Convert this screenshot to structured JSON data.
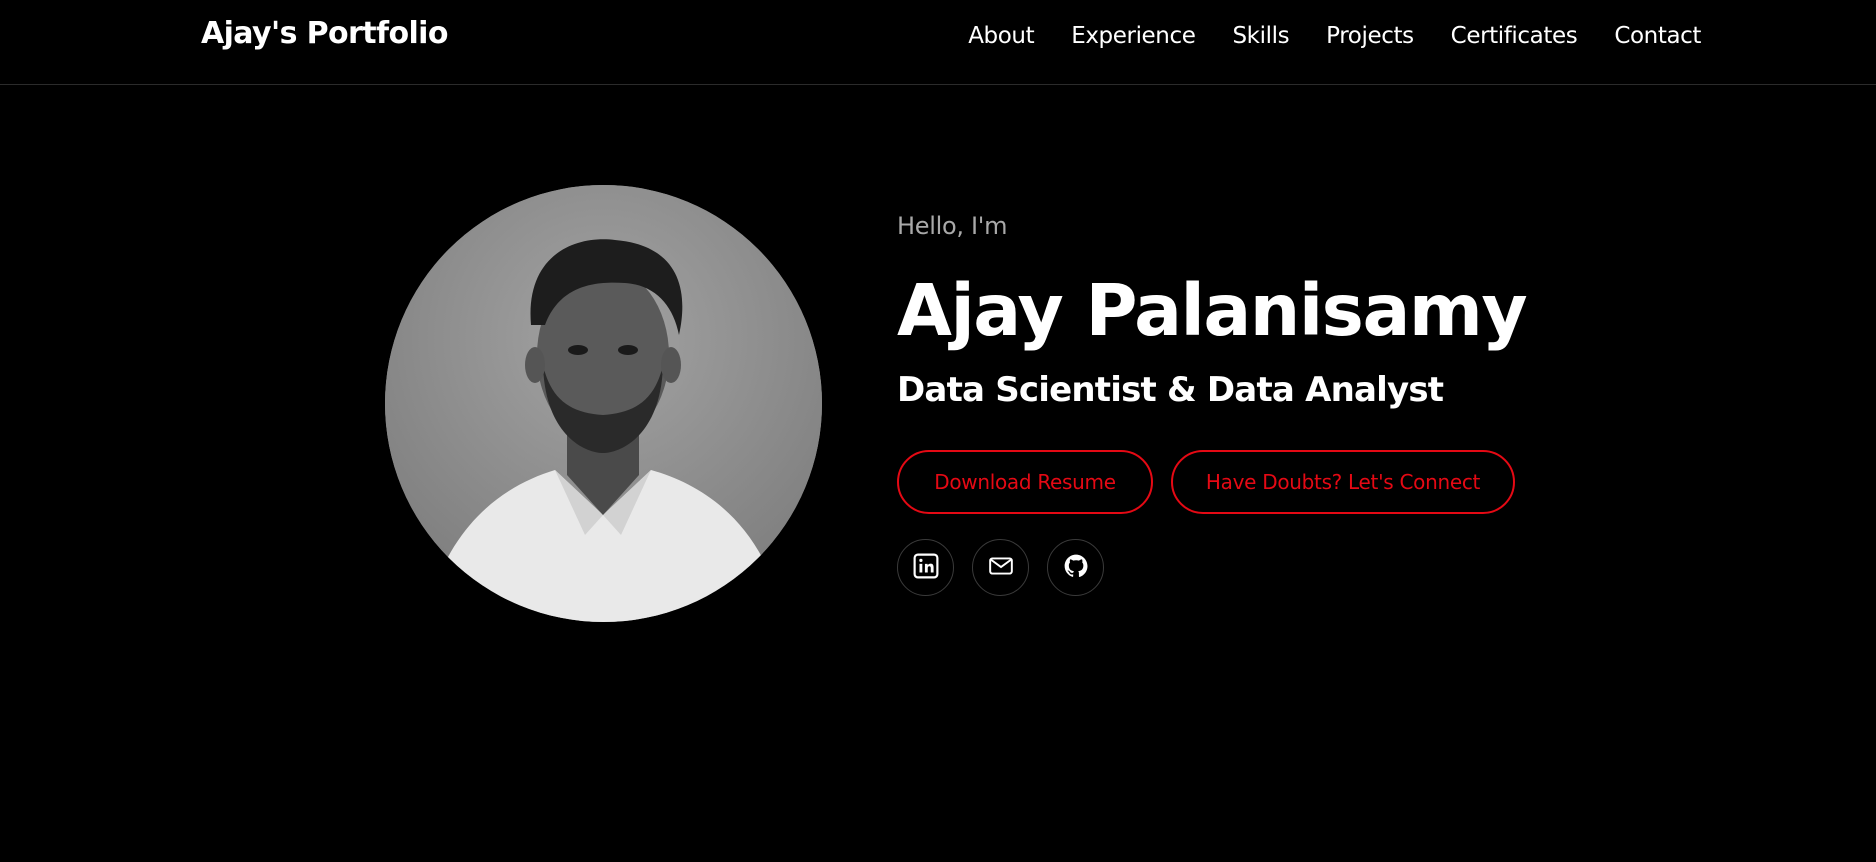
{
  "nav": {
    "brand": "Ajay's Portfolio",
    "links": [
      "About",
      "Experience",
      "Skills",
      "Projects",
      "Certificates",
      "Contact"
    ]
  },
  "hero": {
    "greeting": "Hello, I'm",
    "name": "Ajay Palanisamy",
    "role": "Data Scientist & Data Analyst",
    "buttons": {
      "resume": "Download Resume",
      "connect": "Have Doubts? Let's Connect"
    },
    "socials": [
      {
        "icon": "linkedin-icon"
      },
      {
        "icon": "email-icon"
      },
      {
        "icon": "github-icon"
      }
    ]
  },
  "colors": {
    "background": "#000000",
    "accent": "#e50914",
    "text": "#ffffff",
    "muted": "#a9a9a9"
  }
}
